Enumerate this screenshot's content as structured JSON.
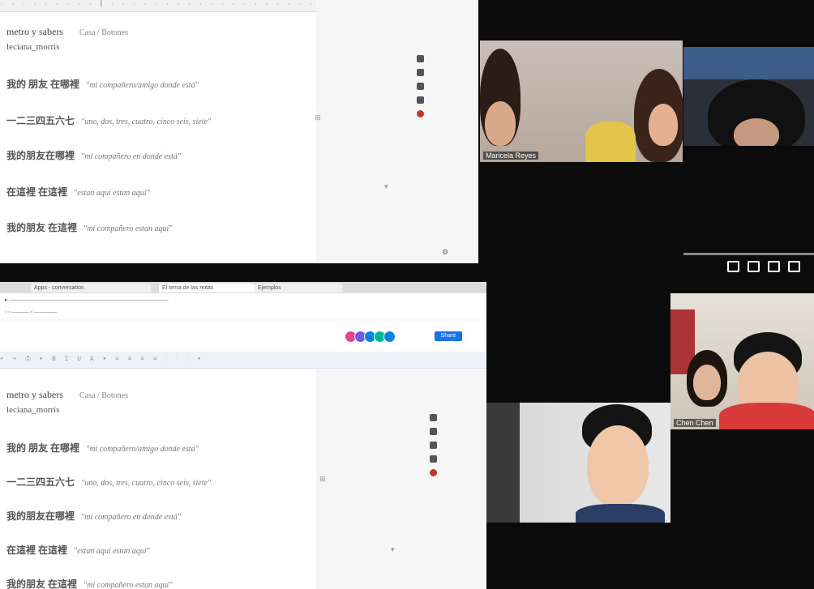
{
  "doc_top": {
    "title": "metro y sabers",
    "subtitle": "Casa / Botones",
    "author": "leciana_morris",
    "lines": [
      {
        "cn": "我的 朋友 在哪裡",
        "es": "\"mi compañero/amigo donde está\""
      },
      {
        "cn": "一二三四五六七",
        "es": "\"uno, dos, tres, cuatro, cinco seis, siete\""
      },
      {
        "cn": "我的朋友在哪裡",
        "es": "\"mi compañero en donde está\""
      },
      {
        "cn": "在這裡 在這裡",
        "es": "\"estan aquí estan aquí\""
      },
      {
        "cn": "我的朋友 在這裡",
        "es": "\"mi compañero estan aquí\""
      }
    ]
  },
  "doc_bottom": {
    "tabs": [
      "Apps - conversation",
      "El tema de las notas",
      "Ejemplos"
    ],
    "share_label": "Share",
    "title": "metro y sabers",
    "subtitle": "Casa / Botones",
    "author": "leciana_morris",
    "lines": [
      {
        "cn": "我的 朋友 在哪裡",
        "es": "\"mi compañero/amigo donde está\""
      },
      {
        "cn": "一二三四五六七",
        "es": "\"uno, dos, tres, cuatro, cinco seis, siete\""
      },
      {
        "cn": "我的朋友在哪裡",
        "es": "\"mi compañero en donde está\""
      },
      {
        "cn": "在這裡 在這裡",
        "es": "\"estan aquí estan aquí\""
      },
      {
        "cn": "我的朋友 在這裡",
        "es": "\"mi compañero estan aquí\""
      }
    ]
  },
  "video": {
    "participants": [
      {
        "name": "Maricela Reyes"
      },
      {
        "name": ""
      },
      {
        "name": "Chen Chen"
      },
      {
        "name": ""
      }
    ]
  },
  "colors": {
    "accent": "#1a73e8",
    "video_bg": "#0b0b0b"
  }
}
